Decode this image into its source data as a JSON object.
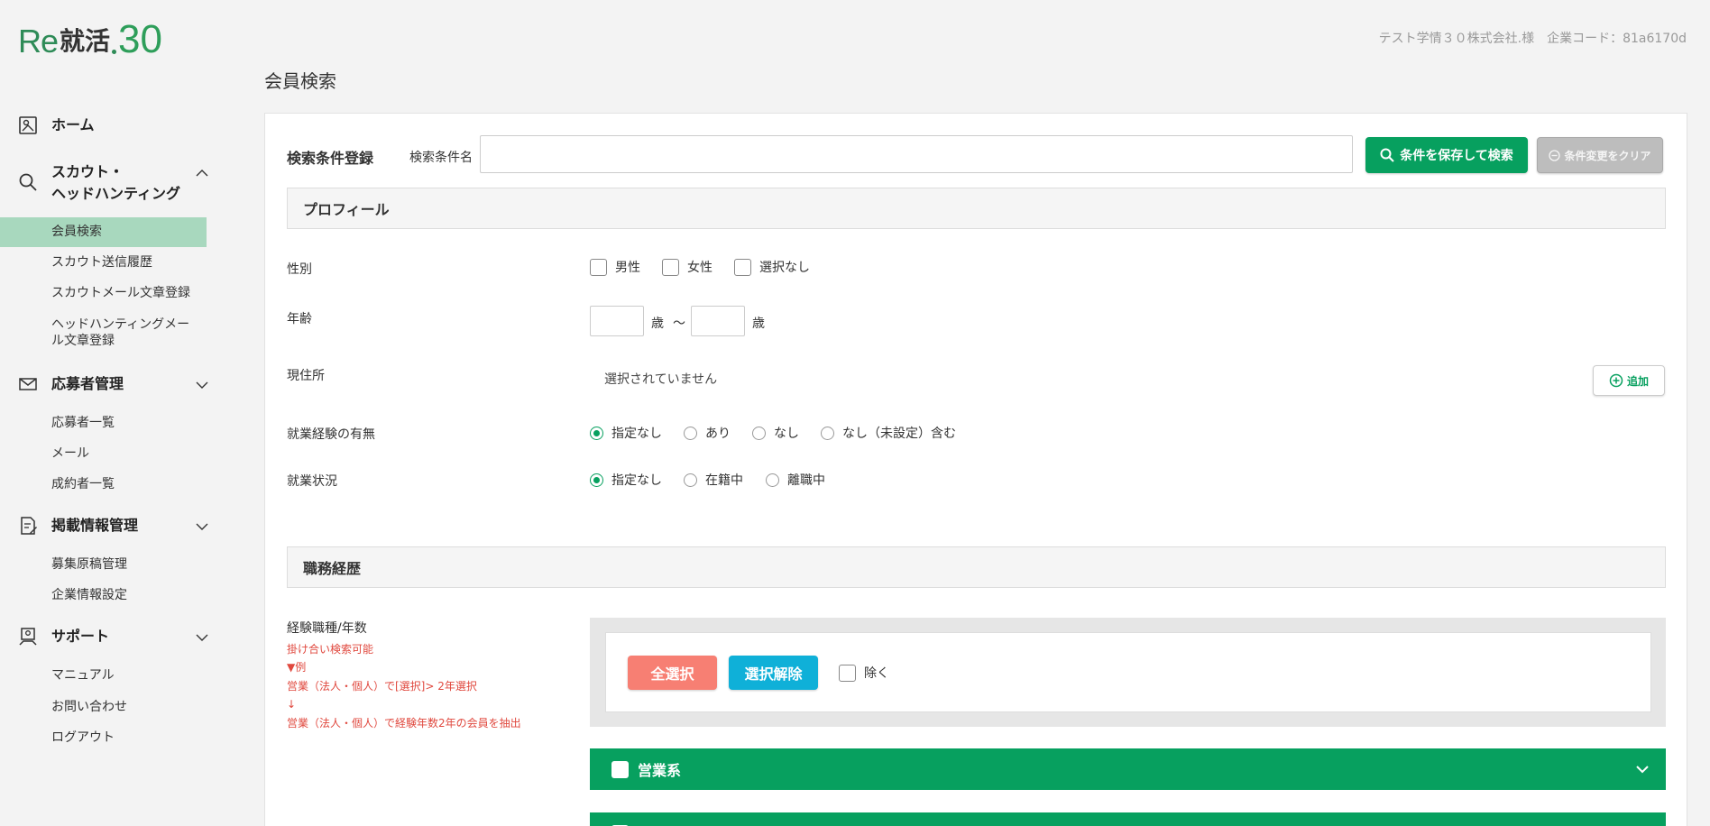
{
  "logo": {
    "re": "Re",
    "shu": "就活",
    "num": "30"
  },
  "header": {
    "company": "テスト学情３０株式会社.様　企業コード：81a6170d"
  },
  "page": {
    "title": "会員検索"
  },
  "sidebar": {
    "home": "ホーム",
    "scout": {
      "title_line1": "スカウト・",
      "title_line2": "ヘッドハンティング",
      "items": [
        "会員検索",
        "スカウト送信履歴",
        "スカウトメール文章登録",
        "ヘッドハンティングメー",
        "ル文章登録"
      ]
    },
    "applicants": {
      "title": "応募者管理",
      "items": [
        "応募者一覧",
        "メール",
        "成約者一覧"
      ]
    },
    "posting": {
      "title": "掲載情報管理",
      "items": [
        "募集原稿管理",
        "企業情報設定"
      ]
    },
    "support": {
      "title": "サポート",
      "items": [
        "マニュアル",
        "お問い合わせ",
        "ログアウト"
      ]
    }
  },
  "search": {
    "register_label": "検索条件登録",
    "name_label": "検索条件名",
    "name_value": "",
    "save_button": "条件を保存して検索",
    "clear_button": "条件変更をクリア"
  },
  "profile": {
    "section": "プロフィール",
    "gender": {
      "label": "性別",
      "options": [
        "男性",
        "女性",
        "選択なし"
      ]
    },
    "age": {
      "label": "年齢",
      "unit": "歳",
      "sep": "〜"
    },
    "address": {
      "label": "現住所",
      "value": "選択されていません",
      "add_button": "追加"
    },
    "experience": {
      "label": "就業経験の有無",
      "options": [
        "指定なし",
        "あり",
        "なし",
        "なし（未設定）含む"
      ],
      "selected": 0
    },
    "status": {
      "label": "就業状況",
      "options": [
        "指定なし",
        "在籍中",
        "離職中"
      ],
      "selected": 0
    }
  },
  "career": {
    "section": "職務経歴",
    "label": "経験職種/年数",
    "notes": [
      "掛け合い検索可能",
      "▼例",
      "営業（法人・個人）で[選択]> 2年選択",
      "↓",
      "営業（法人・個人）で経験年数2年の会員を抽出"
    ],
    "select_all": "全選択",
    "deselect": "選択解除",
    "exclude": "除く",
    "categories": [
      "営業系"
    ]
  },
  "colors": {
    "accent": "#07a05f",
    "select_all": "#f77f73",
    "deselect": "#0fb0d8",
    "active_nav": "#a8d8be"
  }
}
